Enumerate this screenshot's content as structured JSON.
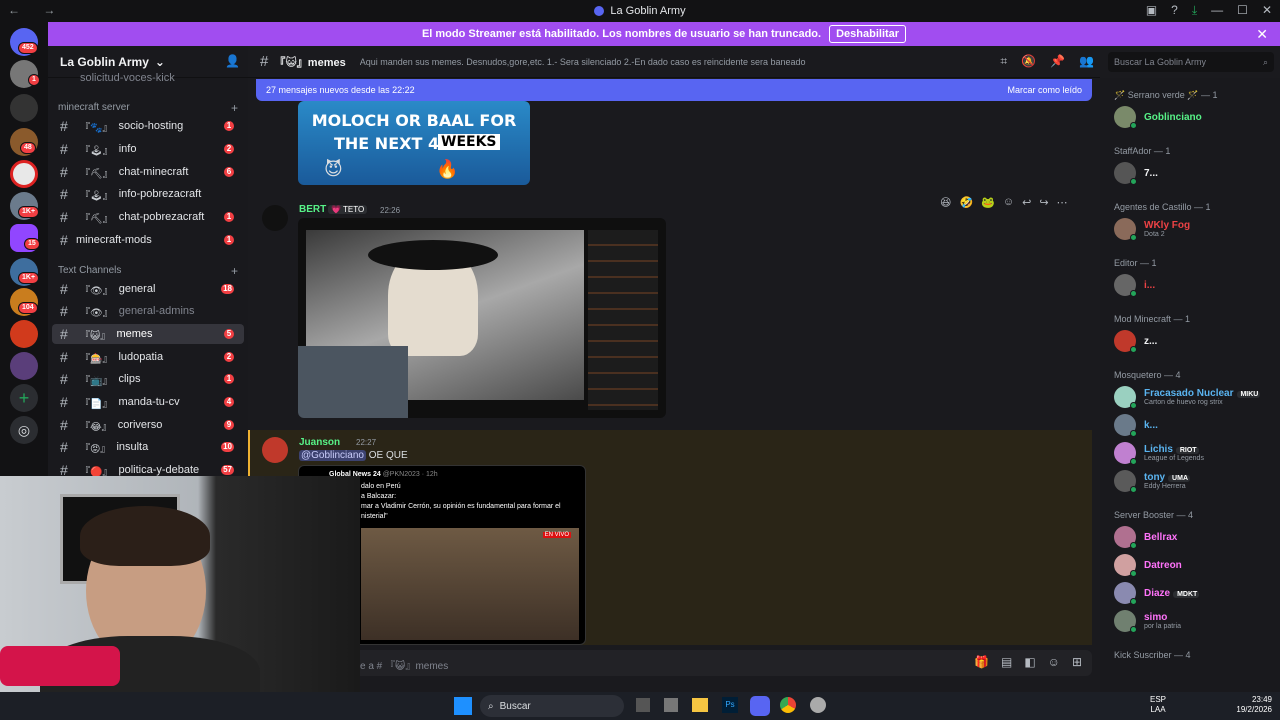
{
  "window": {
    "title": "La Goblin Army"
  },
  "banner": {
    "text": "El modo Streamer está habilitado. Los nombres de usuario se han truncado.",
    "button": "Deshabilitar"
  },
  "rail_badges": [
    "452",
    "1",
    "48",
    "1K+",
    "15",
    "1K+",
    "104"
  ],
  "server": {
    "name": "La Goblin Army"
  },
  "sidebar": {
    "cut_item": "solicitud-voces-kick",
    "categories": {
      "minecraft": "minecraft server",
      "text": "Text Channels"
    },
    "channels": [
      {
        "emoji": "『🐾』",
        "name": "socio-hosting",
        "count": "1"
      },
      {
        "emoji": "『🕹』",
        "name": "info",
        "count": "2"
      },
      {
        "emoji": "『⛏』",
        "name": "chat-minecraft",
        "count": "6"
      },
      {
        "emoji": "『🕹』",
        "name": "info-pobrezacraft",
        "count": ""
      },
      {
        "emoji": "『⛏』",
        "name": "chat-pobrezacraft",
        "count": "1"
      },
      {
        "emoji": "",
        "name": "minecraft-mods",
        "count": "1"
      },
      {
        "emoji": "『👁』",
        "name": "general",
        "count": "18"
      },
      {
        "emoji": "『👁』",
        "name": "general-admins",
        "count": ""
      },
      {
        "emoji": "『😺』",
        "name": "memes",
        "count": "5"
      },
      {
        "emoji": "『🎰』",
        "name": "ludopatia",
        "count": "2"
      },
      {
        "emoji": "『📺』",
        "name": "clips",
        "count": "1"
      },
      {
        "emoji": "『📄』",
        "name": "manda-tu-cv",
        "count": "4"
      },
      {
        "emoji": "『😂』",
        "name": "coriverso",
        "count": "9"
      },
      {
        "emoji": "『😡』",
        "name": "insulta",
        "count": "10"
      },
      {
        "emoji": "『🔴』",
        "name": "politica-y-debate",
        "count": "57"
      }
    ]
  },
  "channel": {
    "name": "『😺』memes",
    "topic": "Aqui manden sus memes. Desnudos,gore,etc. 1.- Sera silenciado 2.-En dado caso es reincidente sera baneado"
  },
  "search": {
    "placeholder": "Buscar La Goblin Army"
  },
  "newbar": {
    "text": "27 mensajes nuevos desde las 22:22",
    "action": "Marcar como leído"
  },
  "messages": [
    {
      "image_caption_lines": [
        "MOLOCH OR BAAL FOR",
        "THE NEXT 4",
        "WEEKS"
      ]
    },
    {
      "user": "BERT",
      "tag": "TETO",
      "time": "22:26"
    },
    {
      "user": "Juanson",
      "time": "22:27",
      "mention": "@Goblinciano",
      "text": "OE QUE",
      "embed": {
        "author": "Global News 24",
        "handle": "@PKN2023 · 12h",
        "line1": "dalo en Perú",
        "line2": "a Balcazar:",
        "line3": "mar a Vladimir Cerrón, su opinión es fundamental para formar el",
        "line4": "nisterial\"",
        "live": "EN VIVO"
      }
    }
  ],
  "composer": {
    "placeholder": "e a # 『😺』memes"
  },
  "members": {
    "roles": [
      {
        "label": "🪄 Serrano verde 🪄 — 1",
        "members": [
          {
            "name": "Goblinciano",
            "color": "#57f287",
            "sub": ""
          }
        ]
      },
      {
        "label": "StaffAdor — 1",
        "members": [
          {
            "name": "7...",
            "color": "#f2f3f5",
            "sub": ""
          }
        ]
      },
      {
        "label": "Agentes de Castillo — 1",
        "members": [
          {
            "name": "WKly Fog",
            "color": "#ed4245",
            "sub": "Dota 2"
          }
        ]
      },
      {
        "label": "Editor — 1",
        "members": [
          {
            "name": "i...",
            "color": "#ed4245",
            "sub": ""
          }
        ]
      },
      {
        "label": "Mod Minecraft — 1",
        "members": [
          {
            "name": "z...",
            "color": "#f2f3f5",
            "sub": ""
          }
        ]
      },
      {
        "label": "Mosquetero — 4",
        "members": [
          {
            "name": "Fracasado Nuclear",
            "color": "#5ab4f0",
            "tag": "MIKU",
            "sub": "Carton de huevo rog strix"
          },
          {
            "name": "k...",
            "color": "#5ab4f0",
            "sub": ""
          },
          {
            "name": "Lichis",
            "color": "#5ab4f0",
            "tag": "RIOT",
            "sub": "League of Legends"
          },
          {
            "name": "tony",
            "color": "#5ab4f0",
            "tag": "UMA",
            "sub": "Eddy Herrera"
          }
        ]
      },
      {
        "label": "Server Booster — 4",
        "members": [
          {
            "name": "Bellrax",
            "color": "#ff73fa",
            "sub": ""
          },
          {
            "name": "Datreon",
            "color": "#ff73fa",
            "sub": ""
          },
          {
            "name": "Diaze",
            "color": "#ff73fa",
            "tag": "MDKT",
            "sub": ""
          },
          {
            "name": "simo",
            "color": "#ff73fa",
            "sub": "por la patria"
          }
        ]
      },
      {
        "label": "Kick Suscriber — 4",
        "members": []
      }
    ]
  },
  "taskbar": {
    "search": "Buscar",
    "lang1": "ESP",
    "lang2": "LAA",
    "time": "23:49",
    "date": "19/2/2026"
  },
  "colors": {
    "accent": "#5865f2",
    "streamer": "#a14df0",
    "bert": "#57f287",
    "juanson": "#57f287"
  }
}
